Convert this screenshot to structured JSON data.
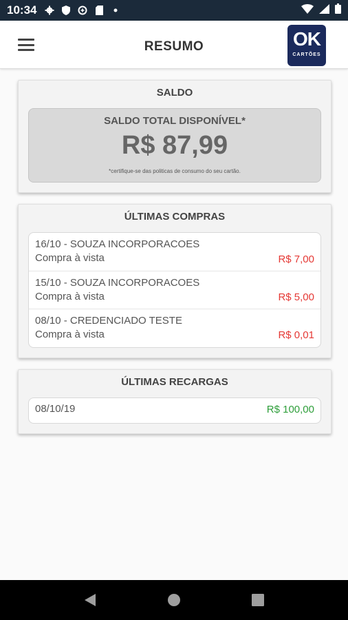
{
  "status_bar": {
    "time": "10:34",
    "icons": [
      "gear-icon",
      "shield-icon",
      "data-saver-icon",
      "sim-card-icon",
      "dot-icon"
    ],
    "right_icons": [
      "wifi-icon",
      "signal-icon",
      "battery-icon"
    ]
  },
  "app_bar": {
    "title": "RESUMO",
    "logo_text": "OK",
    "logo_sub": "CARTÕES",
    "brand_color": "#1b2a5c"
  },
  "saldo": {
    "heading": "SALDO",
    "label": "SALDO TOTAL DISPONÍVEL*",
    "value": "R$ 87,99",
    "note": "*certifique-se das politicas de consumo do seu cartão."
  },
  "compras": {
    "heading": "ÚLTIMAS COMPRAS",
    "items": [
      {
        "description": "16/10 - SOUZA INCORPORACOES",
        "type": "Compra à vista",
        "amount": "R$ 7,00"
      },
      {
        "description": "15/10 - SOUZA INCORPORACOES",
        "type": "Compra à vista",
        "amount": "R$ 5,00"
      },
      {
        "description": "08/10 - CREDENCIADO TESTE",
        "type": "Compra à vista",
        "amount": "R$ 0,01"
      }
    ],
    "amount_color": "#e53935"
  },
  "recargas": {
    "heading": "ÚLTIMAS RECARGAS",
    "items": [
      {
        "date": "08/10/19",
        "amount": "R$ 100,00"
      }
    ],
    "amount_color": "#2e9e3a"
  },
  "nav_bar": {
    "buttons": [
      "back-icon",
      "home-icon",
      "recents-icon"
    ]
  }
}
